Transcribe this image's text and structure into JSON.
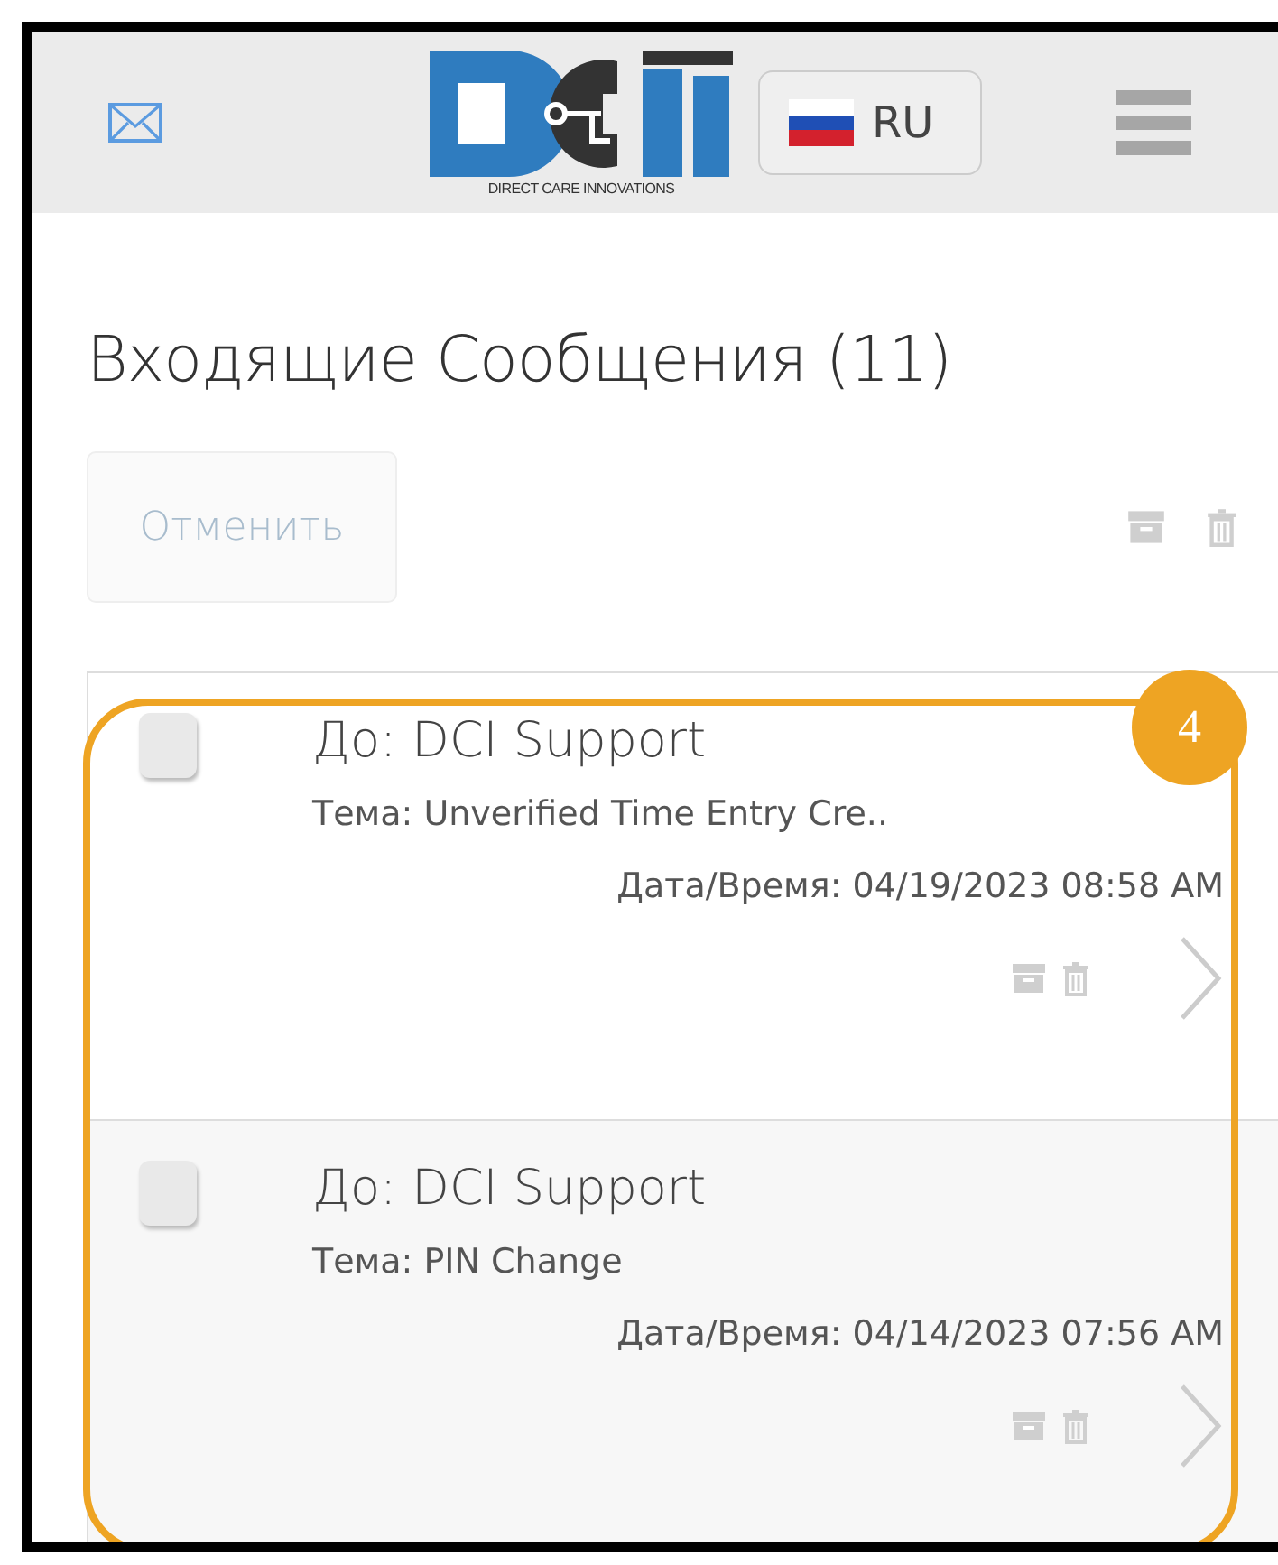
{
  "header": {
    "logo_caption": "DIRECT CARE INNOVATIONS",
    "language": "RU"
  },
  "title": "Входящие Сообщения (11)",
  "cancel_button": "Отменить",
  "messages": [
    {
      "to": "До: DCI Support",
      "subject": "Тема: Unverified Time Entry Cre..",
      "datetime": "Дата/Время: 04/19/2023 08:58 AM",
      "checked": false
    },
    {
      "to": "До: DCI Support",
      "subject": "Тема: PIN Change",
      "datetime": "Дата/Время: 04/14/2023 07:56 AM",
      "checked": false
    }
  ],
  "annotation": {
    "label": "4"
  }
}
